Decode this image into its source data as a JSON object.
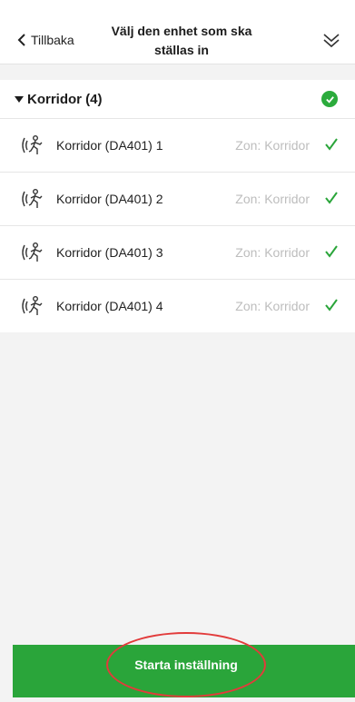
{
  "header": {
    "back_label": "Tillbaka",
    "title": "Välj den enhet som ska ställas in"
  },
  "group": {
    "label": "Korridor (4)"
  },
  "devices": [
    {
      "name": "Korridor (DA401) 1",
      "zone": "Zon: Korridor"
    },
    {
      "name": "Korridor (DA401) 2",
      "zone": "Zon: Korridor"
    },
    {
      "name": "Korridor (DA401) 3",
      "zone": "Zon: Korridor"
    },
    {
      "name": "Korridor (DA401) 4",
      "zone": "Zon: Korridor"
    }
  ],
  "footer": {
    "start_label": "Starta inställning"
  },
  "colors": {
    "accent": "#2aa53a",
    "highlight": "#e23b3b",
    "zone_text": "#bdbdbd"
  },
  "icons": {
    "back": "chevron-left-icon",
    "collapse": "double-chevron-down-icon",
    "group_caret": "caret-down-icon",
    "group_status": "check-circle-icon",
    "device": "motion-sensor-icon",
    "device_status": "checkmark-icon"
  }
}
